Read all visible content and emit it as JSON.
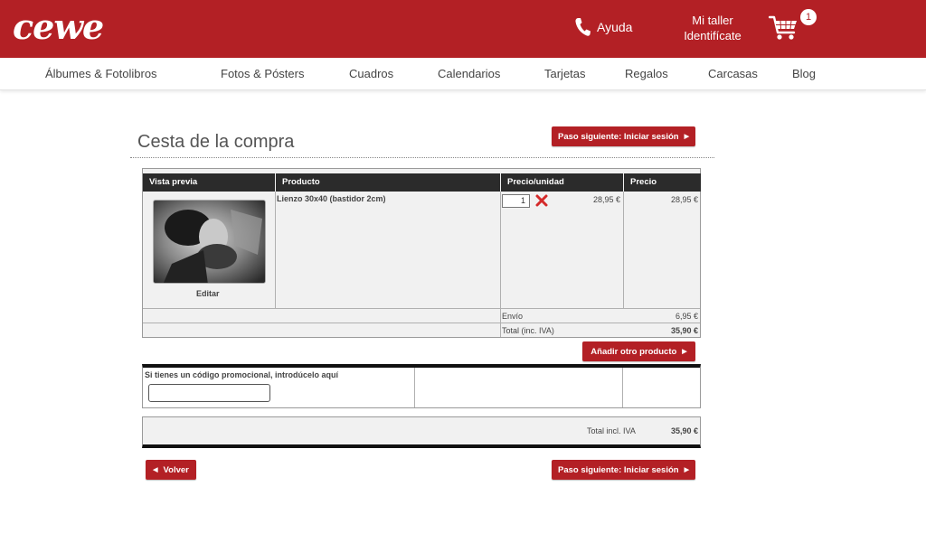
{
  "header": {
    "logo": "cewe",
    "help_label": "Ayuda",
    "account_line1": "Mi taller",
    "account_line2": "Identifícate",
    "cart_count": "1",
    "brand_color": "#b32025"
  },
  "nav": {
    "items": [
      "Álbumes & Fotolibros",
      "Fotos & Pósters",
      "Cuadros",
      "Calendarios",
      "Tarjetas",
      "Regalos",
      "Carcasas",
      "Blog"
    ]
  },
  "page": {
    "title": "Cesta de la compra",
    "next_step_label": "Paso siguiente: Iniciar sesión",
    "add_product_label": "Añadir otro producto",
    "back_label": "Volver"
  },
  "cart_table": {
    "headers": [
      "Vista previa",
      "Producto",
      "Precio/unidad",
      "Precio"
    ],
    "item": {
      "name": "Lienzo 30x40 (bastidor 2cm)",
      "edit_label": "Editar",
      "quantity": "1",
      "unit_price": "28,95 €",
      "price": "28,95 €"
    },
    "shipping_label": "Envío",
    "shipping_value": "6,95 €",
    "total_label": "Total (inc. IVA)",
    "total_value": "35,90 €"
  },
  "promo": {
    "label": "Si tienes un código promocional, introdúcelo aquí",
    "placeholder": ""
  },
  "summary": {
    "total_label": "Total incl. IVA",
    "total_value": "35,90 €"
  }
}
